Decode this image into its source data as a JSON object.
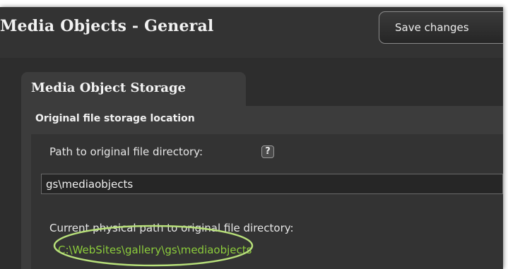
{
  "header": {
    "title": "Media Objects - General",
    "save_label": "Save changes"
  },
  "tab": {
    "label": "Media Object Storage"
  },
  "section": {
    "heading": "Original file storage location",
    "path_label": "Path to original file directory:",
    "help_symbol": "?",
    "path_value": "gs\\mediaobjects",
    "current_label": "Current physical path to original file directory:",
    "current_path": "C:\\WebSites\\gallery\\gs\\mediaobjects"
  },
  "colors": {
    "background": "#2d2d2d",
    "panel": "#3c3c3c",
    "path_text": "#8ccc3c",
    "highlight": "#b8e07a"
  }
}
